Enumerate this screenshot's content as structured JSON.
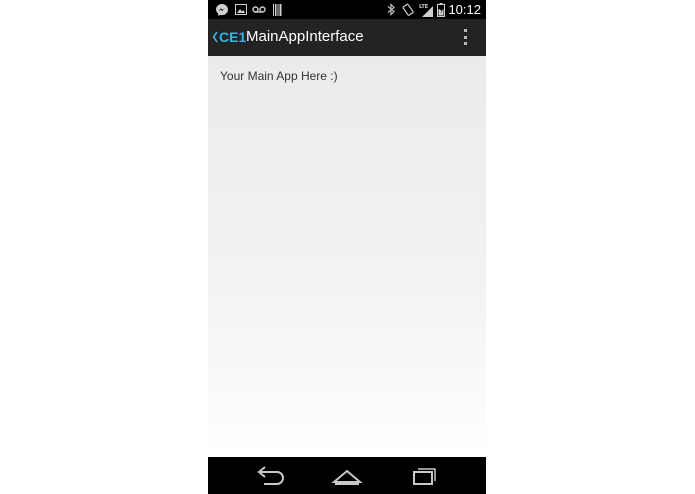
{
  "status_bar": {
    "time": "10:12",
    "network_type": "LTE",
    "left_icons": [
      "messenger-icon",
      "gallery-icon",
      "voicemail-icon",
      "barcode-icon"
    ],
    "right_icons": [
      "bluetooth-icon",
      "auto-rotate-icon",
      "signal-icon",
      "battery-icon"
    ]
  },
  "action_bar": {
    "app_logo_text": "CE1",
    "title": "MainAppInterface",
    "accent_color": "#33b5e5"
  },
  "content": {
    "text": "Your Main App Here :)"
  },
  "nav_bar": {
    "buttons": [
      "back-icon",
      "home-icon",
      "recent-apps-icon"
    ]
  }
}
